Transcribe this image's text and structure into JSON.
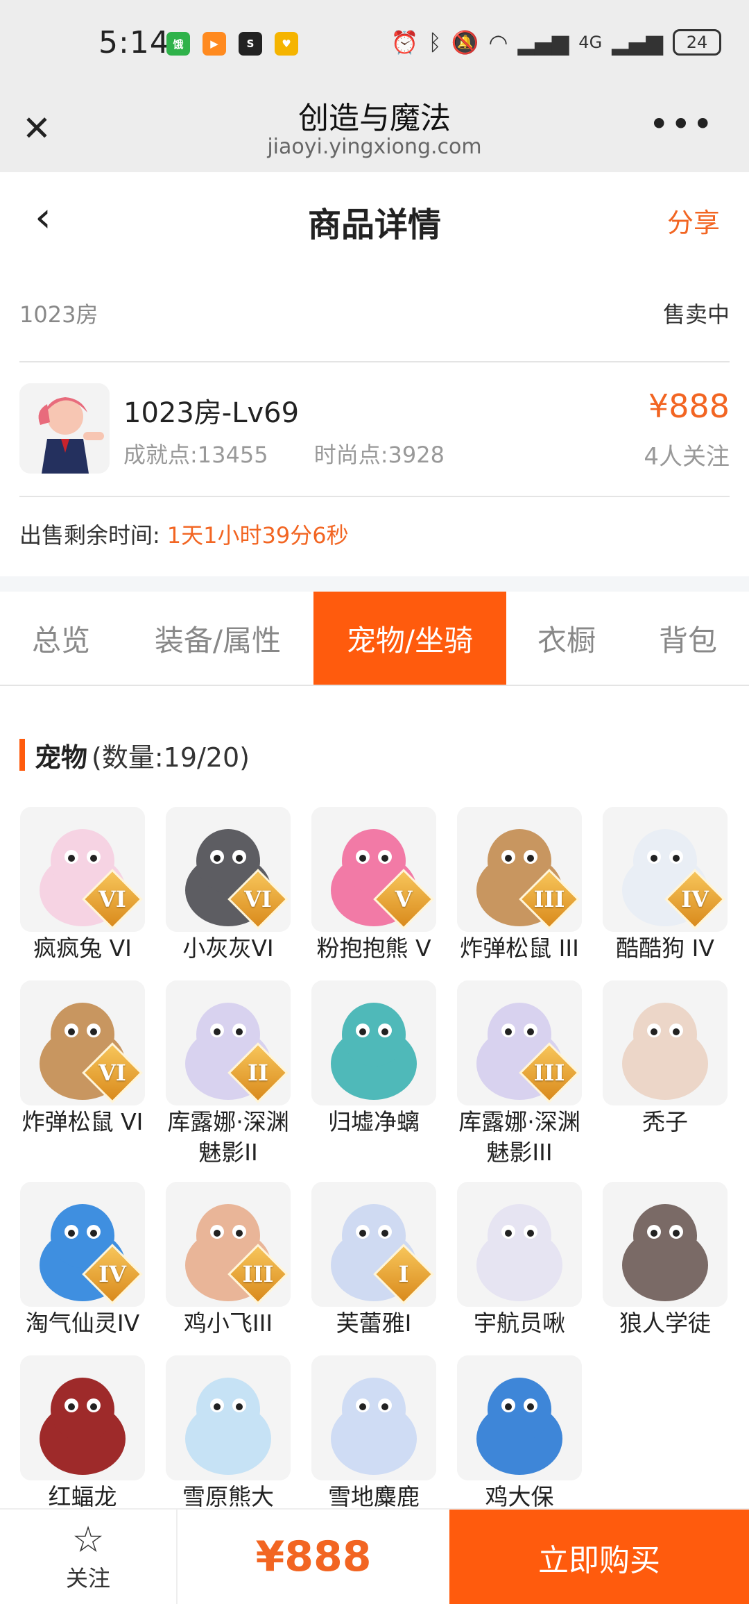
{
  "status_bar": {
    "time": "5:14",
    "battery": "24",
    "network": "4G"
  },
  "browser": {
    "title": "创造与魔法",
    "url": "jiaoyi.yingxiong.com"
  },
  "header": {
    "title": "商品详情",
    "share": "分享"
  },
  "room": {
    "id": "1023房",
    "status": "售卖中"
  },
  "product": {
    "name": "1023房-Lv69",
    "achievement": "成就点:13455",
    "fashion": "时尚点:3928",
    "price": "¥888",
    "followers": "4人关注"
  },
  "remaining": {
    "label": "出售剩余时间:",
    "value": "1天1小时39分6秒"
  },
  "tabs": [
    "总览",
    "装备/属性",
    "宠物/坐骑",
    "衣橱",
    "背包"
  ],
  "active_tab": 2,
  "section": {
    "title": "宠物",
    "count": "(数量:19/20)"
  },
  "pets": [
    {
      "name": "疯疯兔 VI",
      "badge": "VI",
      "color": "#f6d3e3"
    },
    {
      "name": "小灰灰VI",
      "badge": "VI",
      "color": "#5d5d62"
    },
    {
      "name": "粉抱抱熊 V",
      "badge": "V",
      "color": "#f27aa6"
    },
    {
      "name": "炸弹松鼠 III",
      "badge": "III",
      "color": "#c89660"
    },
    {
      "name": "酷酷狗 IV",
      "badge": "IV",
      "color": "#e9eef5"
    },
    {
      "name": "炸弹松鼠 VI",
      "badge": "VI",
      "color": "#c89660"
    },
    {
      "name": "库露娜·深渊魅影II",
      "badge": "II",
      "color": "#d8d2ef"
    },
    {
      "name": "归墟净螭",
      "badge": "",
      "color": "#4fb9b9"
    },
    {
      "name": "库露娜·深渊魅影III",
      "badge": "III",
      "color": "#d8d2ef"
    },
    {
      "name": "秃子",
      "badge": "",
      "color": "#ecd6c8"
    },
    {
      "name": "淘气仙灵IV",
      "badge": "IV",
      "color": "#3f8fe0"
    },
    {
      "name": "鸡小飞III",
      "badge": "III",
      "color": "#e9b598"
    },
    {
      "name": "芙蕾雅I",
      "badge": "I",
      "color": "#cfdaf2"
    },
    {
      "name": "宇航员啾",
      "badge": "",
      "color": "#e6e4f2"
    },
    {
      "name": "狼人学徒",
      "badge": "",
      "color": "#7a6a66"
    },
    {
      "name": "红蝠龙",
      "badge": "",
      "color": "#9e2a2a"
    },
    {
      "name": "雪原熊大",
      "badge": "",
      "color": "#c6e2f5"
    },
    {
      "name": "雪地麋鹿",
      "badge": "",
      "color": "#cfdcf4"
    },
    {
      "name": "鸡大保",
      "badge": "",
      "color": "#3e86d8"
    }
  ],
  "bottom": {
    "follow": "关注",
    "price": "¥888",
    "buy": "立即购买"
  },
  "colors": {
    "accent": "#ff5b0d",
    "price": "#f26522"
  }
}
